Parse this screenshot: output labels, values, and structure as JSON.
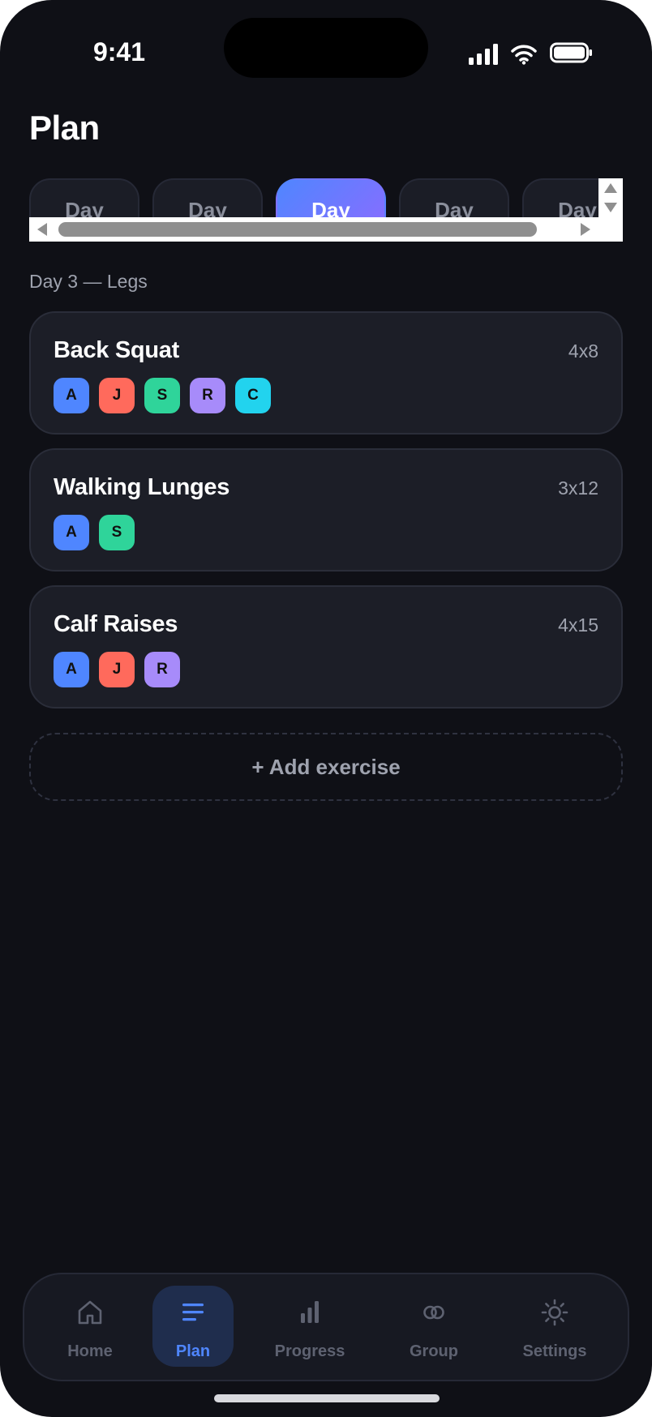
{
  "status": {
    "time": "9:41"
  },
  "page": {
    "title": "Plan"
  },
  "day_tabs": [
    {
      "label": "Day",
      "active": false
    },
    {
      "label": "Day",
      "active": false
    },
    {
      "label": "Day",
      "active": true
    },
    {
      "label": "Day",
      "active": false
    },
    {
      "label": "Day",
      "active": false
    }
  ],
  "section": {
    "label": "Day 3 — Legs"
  },
  "exercises": [
    {
      "name": "Back Squat",
      "sets": "4x8",
      "members": [
        {
          "initial": "A",
          "color": "#4f86ff"
        },
        {
          "initial": "J",
          "color": "#ff6a5c"
        },
        {
          "initial": "S",
          "color": "#2fd49a"
        },
        {
          "initial": "R",
          "color": "#a78bfa"
        },
        {
          "initial": "C",
          "color": "#22d3ee"
        }
      ]
    },
    {
      "name": "Walking Lunges",
      "sets": "3x12",
      "members": [
        {
          "initial": "A",
          "color": "#4f86ff"
        },
        {
          "initial": "S",
          "color": "#2fd49a"
        }
      ]
    },
    {
      "name": "Calf Raises",
      "sets": "4x15",
      "members": [
        {
          "initial": "A",
          "color": "#4f86ff"
        },
        {
          "initial": "J",
          "color": "#ff6a5c"
        },
        {
          "initial": "R",
          "color": "#a78bfa"
        }
      ]
    }
  ],
  "add_button": {
    "label": "+ Add exercise"
  },
  "tabbar": [
    {
      "label": "Home",
      "icon": "home-icon",
      "active": false
    },
    {
      "label": "Plan",
      "icon": "list-icon",
      "active": true
    },
    {
      "label": "Progress",
      "icon": "bar-chart-icon",
      "active": false
    },
    {
      "label": "Group",
      "icon": "group-icon",
      "active": false
    },
    {
      "label": "Settings",
      "icon": "gear-icon",
      "active": false
    }
  ],
  "colors": {
    "accent": "#4f86ff",
    "background": "#0f1016",
    "card": "#1c1e27"
  }
}
